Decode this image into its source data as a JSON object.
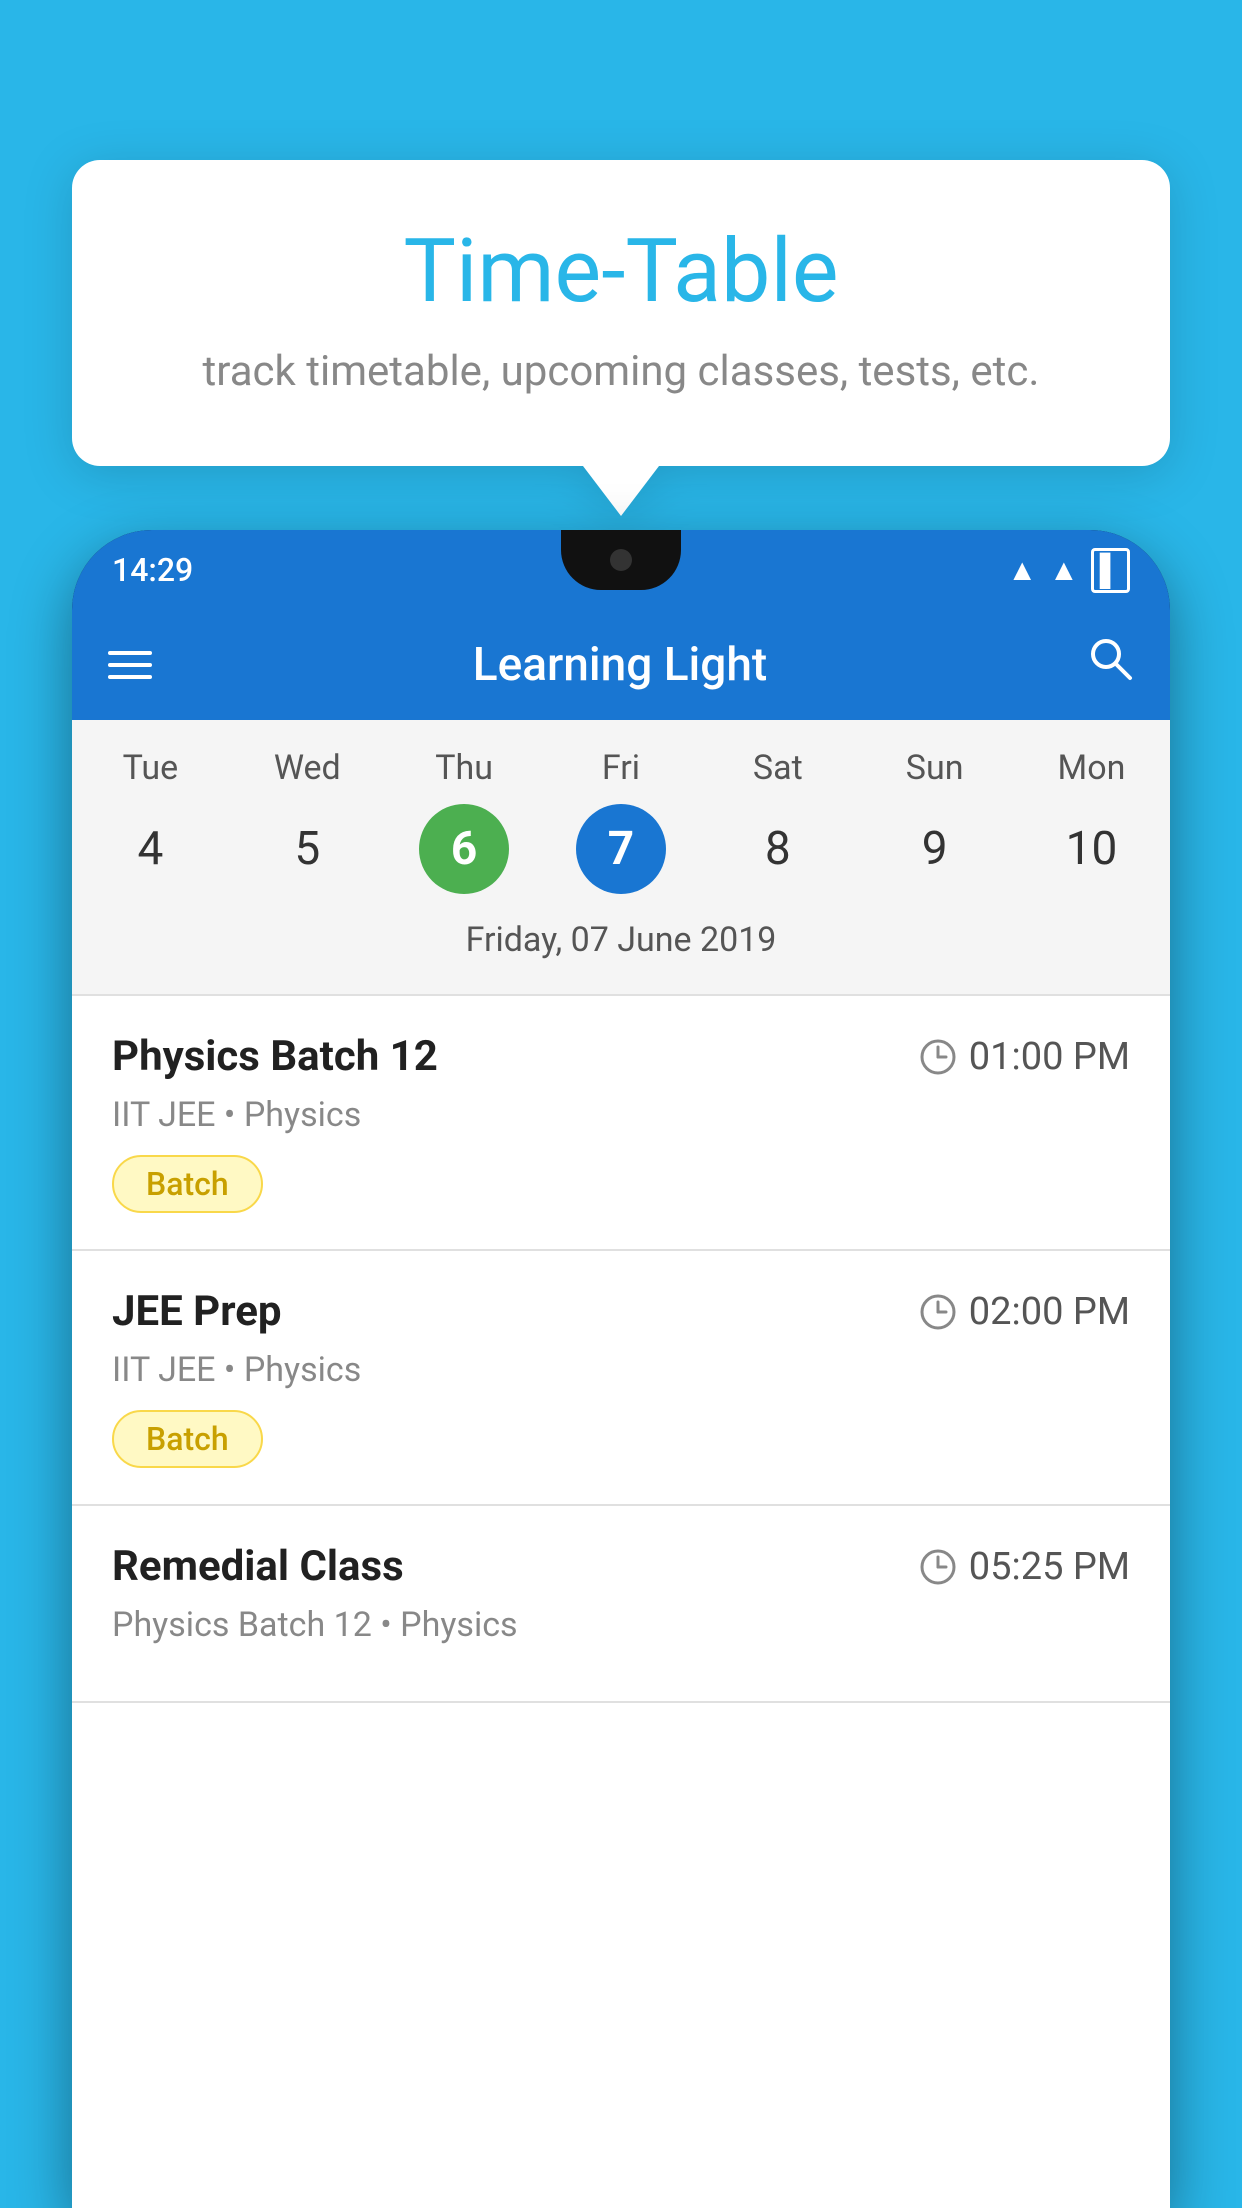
{
  "background_color": "#29b6e8",
  "tooltip": {
    "title": "Time-Table",
    "subtitle": "track timetable, upcoming classes, tests, etc."
  },
  "phone": {
    "status_bar": {
      "time": "14:29"
    },
    "app_bar": {
      "title": "Learning Light"
    },
    "calendar": {
      "days": [
        "Tue",
        "Wed",
        "Thu",
        "Fri",
        "Sat",
        "Sun",
        "Mon"
      ],
      "dates": [
        "4",
        "5",
        "6",
        "7",
        "8",
        "9",
        "10"
      ],
      "today_index": 2,
      "selected_index": 3,
      "selected_label": "Friday, 07 June 2019"
    },
    "schedule": [
      {
        "title": "Physics Batch 12",
        "time": "01:00 PM",
        "meta": "IIT JEE • Physics",
        "badge": "Batch"
      },
      {
        "title": "JEE Prep",
        "time": "02:00 PM",
        "meta": "IIT JEE • Physics",
        "badge": "Batch"
      },
      {
        "title": "Remedial Class",
        "time": "05:25 PM",
        "meta": "Physics Batch 12 • Physics",
        "badge": null
      }
    ]
  }
}
